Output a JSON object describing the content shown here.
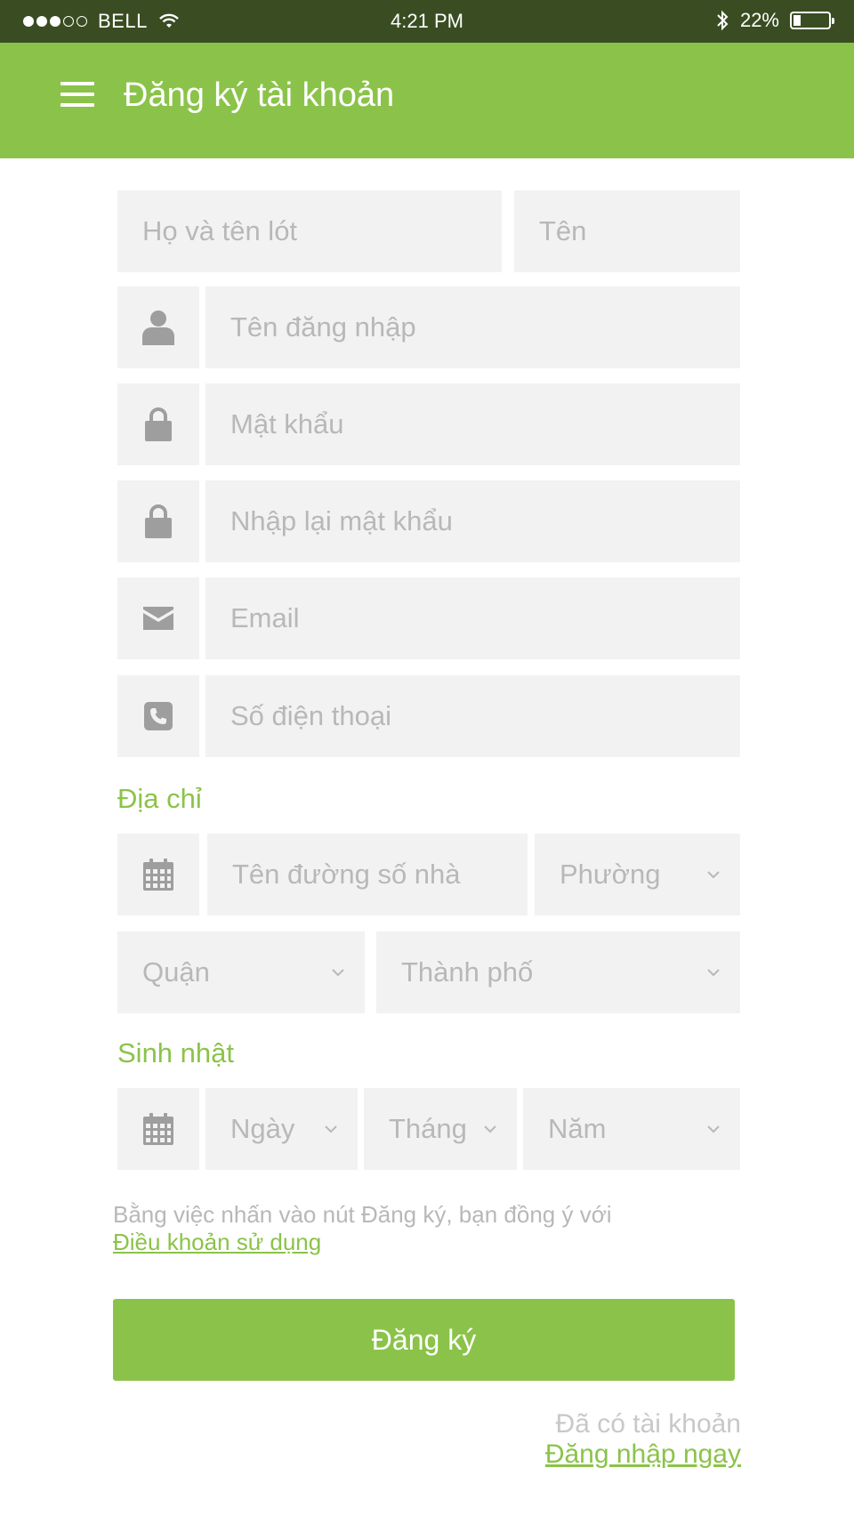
{
  "status_bar": {
    "carrier": "BELL",
    "time": "4:21 PM",
    "battery_percent": "22%",
    "battery_level": 0.22,
    "signal_dots": [
      true,
      true,
      true,
      false,
      false
    ]
  },
  "header": {
    "title": "Đăng ký tài khoản",
    "menu_icon": "hamburger-icon"
  },
  "form": {
    "last_middle_name_placeholder": "Họ và tên lót",
    "first_name_placeholder": "Tên",
    "username_placeholder": "Tên đăng nhập",
    "password_placeholder": "Mật khẩu",
    "confirm_password_placeholder": "Nhập lại mật khẩu",
    "email_placeholder": "Email",
    "phone_placeholder": "Số điện thoại",
    "address_label": "Địa chỉ",
    "street_placeholder": "Tên đường số nhà",
    "ward_select": "Phường",
    "district_select": "Quận",
    "city_select": "Thành phố",
    "birthday_label": "Sinh nhật",
    "day_select": "Ngày",
    "month_select": "Tháng",
    "year_select": "Năm"
  },
  "terms": {
    "text": "Bằng việc nhấn vào nút Đăng ký, bạn đồng ý với",
    "link": "Điều khoản sử dụng"
  },
  "register_button": "Đăng ký",
  "footer": {
    "have_account": "Đã có tài khoản",
    "login_link": "Đăng nhập ngay"
  },
  "colors": {
    "accent": "#8bc34a",
    "status_bar": "#3a4d22",
    "field_bg": "#f2f2f2",
    "placeholder": "#b8b8b8",
    "icon": "#9e9e9e"
  }
}
